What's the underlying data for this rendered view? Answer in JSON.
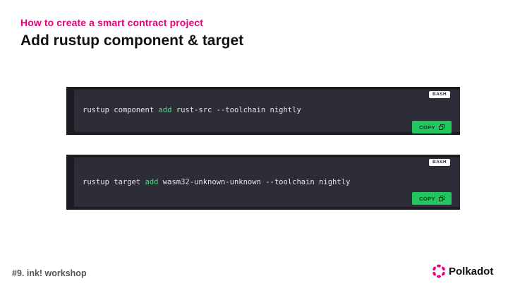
{
  "header": {
    "subtitle": "How to create a smart contract project",
    "title": "Add rustup component & target"
  },
  "code_blocks": [
    {
      "language": "BASH",
      "command": {
        "before": "rustup component ",
        "keyword": "add",
        "after": " rust-src --toolchain nightly"
      },
      "copy_label": "COPY"
    },
    {
      "language": "BASH",
      "command": {
        "before": "rustup target ",
        "keyword": "add",
        "after": " wasm32-unknown-unknown --toolchain nightly"
      },
      "copy_label": "COPY"
    }
  ],
  "footer": {
    "left_text": "#9. ink! workshop",
    "brand_name": "Polkadot"
  },
  "icons": {
    "copy": "copy-icon",
    "brand_logo": "polkadot-logo-icon"
  },
  "colors": {
    "accent": "#e6007a",
    "code_background": "#2c2d36",
    "code_frame": "#1c1c22",
    "keyword": "#4ade80",
    "copy_button": "#22c55e"
  }
}
